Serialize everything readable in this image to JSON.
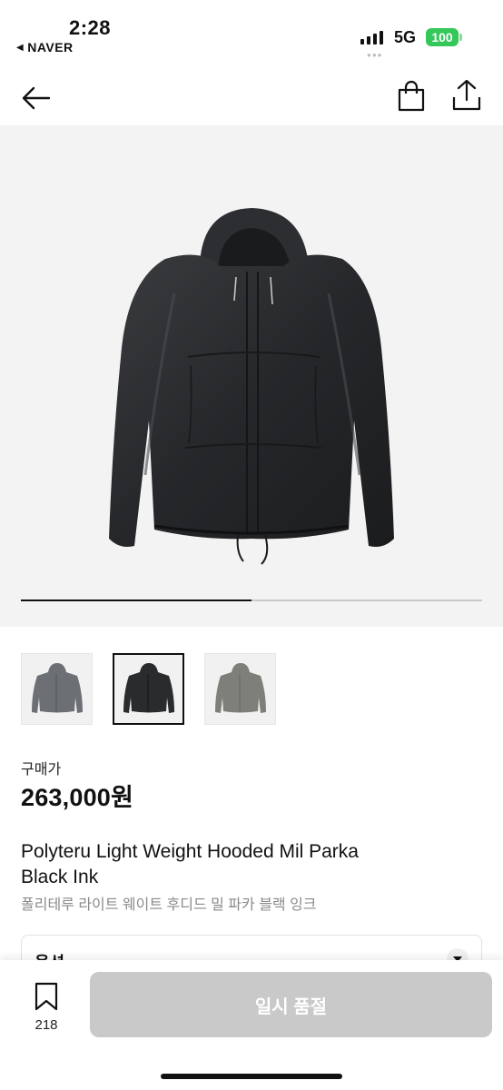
{
  "status_bar": {
    "time": "2:28",
    "back_app": "NAVER",
    "network": "5G",
    "battery": "100"
  },
  "nav": {
    "back_icon": "arrow-left-icon",
    "bag_icon": "shopping-bag-icon",
    "share_icon": "share-icon"
  },
  "gallery": {
    "progress_fraction": 0.5,
    "thumbnails": [
      {
        "name": "thumb-grey-parka",
        "color": "#6c7075",
        "selected": false
      },
      {
        "name": "thumb-black-parka",
        "color": "#2a2b2d",
        "selected": true
      },
      {
        "name": "thumb-olive-parka",
        "color": "#7d7f78",
        "selected": false
      }
    ]
  },
  "product": {
    "price_label": "구매가",
    "price": "263,000원",
    "title_en_line1": "Polyteru Light Weight Hooded Mil Parka",
    "title_en_line2": "Black Ink",
    "title_kr": "폴리테루 라이트 웨이트 후디드 밀 파카 블랙 잉크"
  },
  "option": {
    "label": "옵션"
  },
  "bottom_bar": {
    "bookmark_count": "218",
    "soldout_label": "일시 품절"
  },
  "colors": {
    "accent": "#111111",
    "battery": "#34c759",
    "soldout_bg": "#c9c9c9"
  }
}
